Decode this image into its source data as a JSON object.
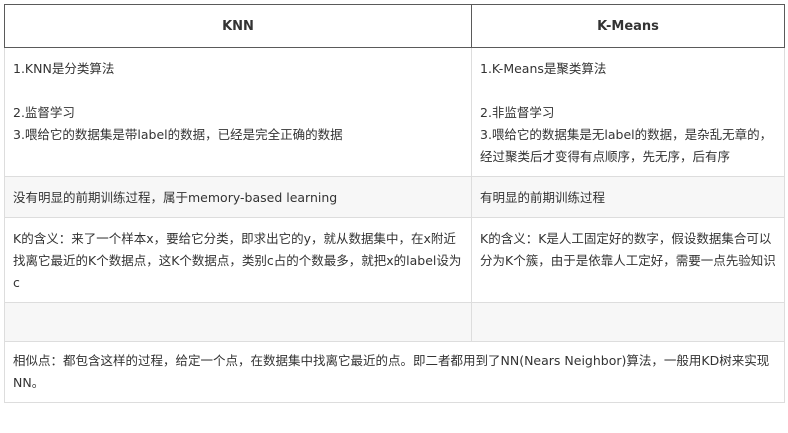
{
  "header": {
    "col1": "KNN",
    "col2": "K-Means"
  },
  "rows": [
    {
      "left": [
        "1.KNN是分类算法",
        "",
        "2.监督学习",
        "3.喂给它的数据集是带label的数据，已经是完全正确的数据"
      ],
      "right": [
        "1.K-Means是聚类算法",
        "",
        "2.非监督学习",
        "3.喂给它的数据集是无label的数据，是杂乱无章的，经过聚类后才变得有点顺序，先无序，后有序"
      ]
    },
    {
      "left": [
        "没有明显的前期训练过程，属于memory-based learning"
      ],
      "right": [
        "有明显的前期训练过程"
      ]
    },
    {
      "left": [
        "K的含义：来了一个样本x，要给它分类，即求出它的y，就从数据集中，在x附近找离它最近的K个数据点，这K个数据点，类别c占的个数最多，就把x的label设为c"
      ],
      "right": [
        "K的含义：K是人工固定好的数字，假设数据集合可以分为K个簇，由于是依靠人工定好，需要一点先验知识"
      ]
    },
    {
      "left": [],
      "right": []
    }
  ],
  "footer": "相似点：都包含这样的过程，给定一个点，在数据集中找离它最近的点。即二者都用到了NN(Nears Neighbor)算法，一般用KD树来实现NN。"
}
